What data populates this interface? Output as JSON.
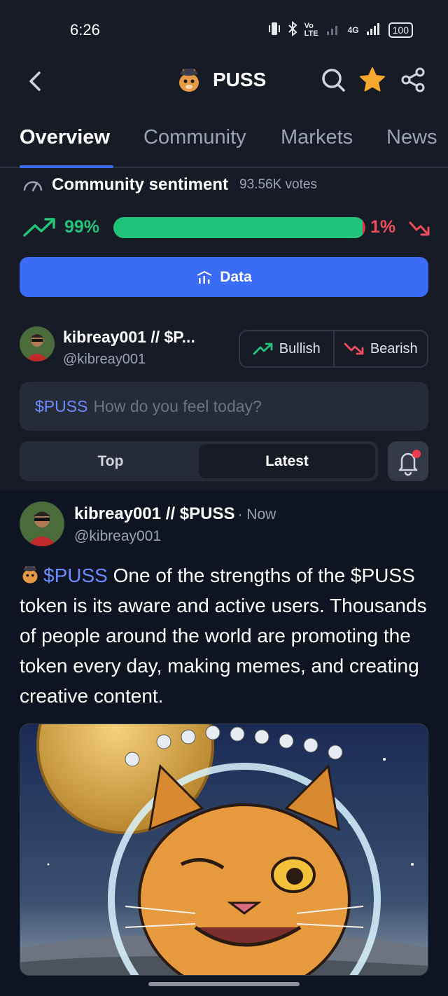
{
  "status_bar": {
    "time": "6:26",
    "network": "4G",
    "battery": "100"
  },
  "header": {
    "title": "PUSS"
  },
  "tabs": [
    {
      "label": "Overview",
      "active": true
    },
    {
      "label": "Community",
      "active": false
    },
    {
      "label": "Markets",
      "active": false
    },
    {
      "label": "News",
      "active": false
    }
  ],
  "sentiment": {
    "title": "Community sentiment",
    "votes": "93.56K votes",
    "bullish_percent_label": "99%",
    "bearish_percent_label": "1%",
    "bullish_fraction": 0.99,
    "colors": {
      "bullish": "#1fc47a",
      "bearish": "#e2324a"
    }
  },
  "data_button": {
    "label": "Data"
  },
  "current_user": {
    "name": "kibreay001 // $P...",
    "handle": "@kibreay001"
  },
  "vote_buttons": {
    "bullish": "Bullish",
    "bearish": "Bearish"
  },
  "compose": {
    "tag": "$PUSS",
    "placeholder": "How do you feel today?"
  },
  "sort": {
    "top": "Top",
    "latest": "Latest",
    "selected": "Latest"
  },
  "post": {
    "author": "kibreay001 // $PUSS",
    "time": "· Now",
    "handle": "@kibreay001",
    "tag": "$PUSS",
    "text": "One of the strengths of the $PUSS token is its aware and active users. Thousands of people around the world are promoting the token every day, making memes, and creating creative content."
  },
  "accent_color": "#3b6cf5"
}
